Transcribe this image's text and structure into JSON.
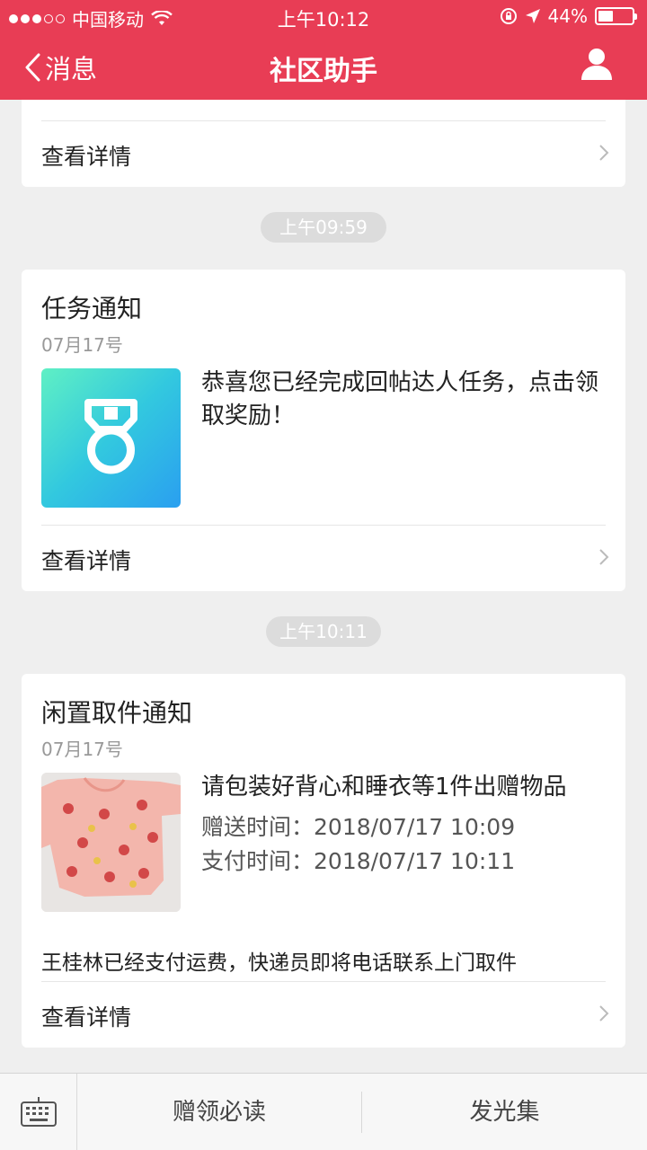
{
  "status_bar": {
    "carrier": "中国移动",
    "time": "上午10:12",
    "battery": "44%",
    "battery_level": 0.44
  },
  "nav": {
    "back_label": "消息",
    "title": "社区助手"
  },
  "cards": {
    "prev": {
      "detail_label": "查看详情"
    },
    "task": {
      "time": "上午09:59",
      "title": "任务通知",
      "date": "07月17号",
      "message": "恭喜您已经完成回帖达人任务，点击领取奖励！",
      "detail_label": "查看详情"
    },
    "pickup": {
      "time": "上午10:11",
      "title": "闲置取件通知",
      "date": "07月17号",
      "item_text": "请包装好背心和睡衣等1件出赠物品",
      "gift_time_label": "赠送时间：",
      "gift_time": "2018/07/17 10:09",
      "pay_time_label": "支付时间：",
      "pay_time": "2018/07/17 10:11",
      "note": "王桂林已经支付运费，快递员即将电话联系上门取件",
      "detail_label": "查看详情"
    }
  },
  "tab_bar": {
    "tab1": "赠领必读",
    "tab2": "发光集"
  },
  "colors": {
    "brand": "#e83d55",
    "background": "#efefef",
    "pill": "#dcdcdc"
  },
  "icons": {
    "back": "chevron-left-icon",
    "user": "user-icon",
    "medal": "medal-icon",
    "keyboard": "keyboard-icon",
    "chevron": "chevron-right-icon"
  }
}
